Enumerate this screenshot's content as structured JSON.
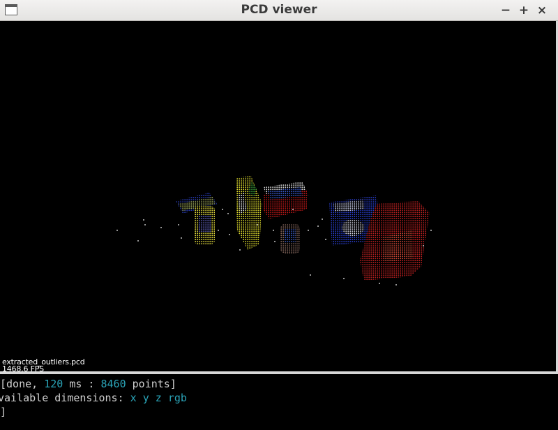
{
  "window": {
    "title": "PCD viewer",
    "buttons": {
      "minimize": "−",
      "maximize": "+",
      "close": "×"
    }
  },
  "viewer": {
    "filename": "extracted_outliers.pcd",
    "fps": "1468.6 FPS",
    "background_color": "#000000"
  },
  "terminal": {
    "line1": {
      "prefix": "[done, ",
      "ms": "120",
      "ms_unit": " ms : ",
      "points": "8460",
      "suffix": " points]"
    },
    "line2": {
      "prefix": "vailable dimensions: ",
      "dims": "x y z rgb"
    },
    "line3": {
      "text": "]"
    }
  }
}
